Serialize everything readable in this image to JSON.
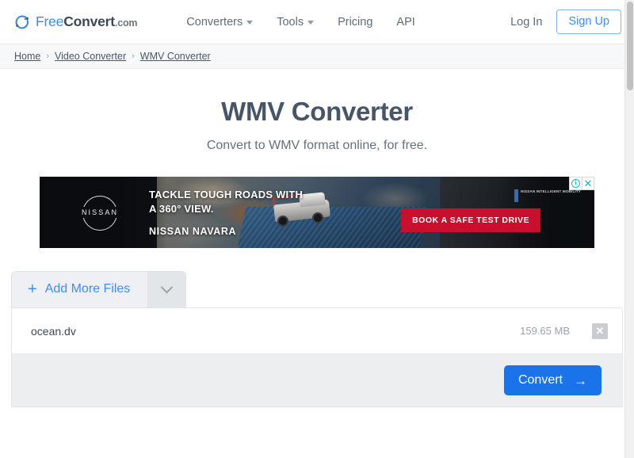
{
  "header": {
    "logo": {
      "icon": "refresh-circle-icon",
      "part1": "Free",
      "part2": "Convert",
      "part3": ".com"
    },
    "nav": [
      {
        "label": "Converters",
        "has_caret": true
      },
      {
        "label": "Tools",
        "has_caret": true
      },
      {
        "label": "Pricing",
        "has_caret": false
      },
      {
        "label": "API",
        "has_caret": false
      }
    ],
    "login_label": "Log In",
    "signup_label": "Sign Up"
  },
  "breadcrumb": {
    "items": [
      "Home",
      "Video Converter",
      "WMV Converter"
    ],
    "separator": "›"
  },
  "hero": {
    "title": "WMV Converter",
    "subtitle": "Convert to WMV format online, for free."
  },
  "ad": {
    "brand": "NISSAN",
    "headline_line1": "TACKLE TOUGH ROADS WITH",
    "headline_line2": "A 360° VIEW.",
    "model": "NISSAN NAVARA",
    "cta": "BOOK A SAFE TEST DRIVE",
    "badge": "Nissan Intelligent Mobility",
    "info_icon": "i",
    "close_icon": "✕"
  },
  "upload": {
    "add_more_plus": "+",
    "add_more_label": "Add More Files",
    "dropdown_icon": "chevron-down-icon",
    "columns": [
      "name",
      "size",
      "remove"
    ],
    "files": [
      {
        "name": "ocean.dv",
        "size": "159.65 MB",
        "remove_icon": "✕"
      }
    ],
    "convert_label": "Convert",
    "convert_arrow": "→"
  },
  "colors": {
    "accent_blue": "#1a73e8",
    "link_blue": "#3c8dff",
    "logo_blue": "#3a8dde",
    "title_slate": "#475569",
    "ad_red": "#c8102e",
    "ad_control_teal": "#19b5c9"
  }
}
